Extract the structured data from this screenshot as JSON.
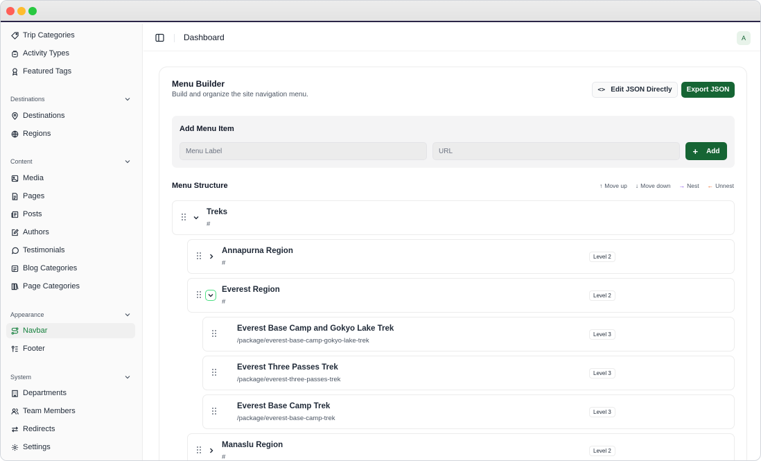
{
  "sidebar": {
    "top_items": [
      {
        "label": "Trip Categories",
        "icon": "tag-icon"
      },
      {
        "label": "Activity Types",
        "icon": "backpack-icon"
      },
      {
        "label": "Featured Tags",
        "icon": "ribbon-icon"
      }
    ],
    "groups": [
      {
        "label": "Destinations",
        "items": [
          {
            "label": "Destinations",
            "icon": "map-pin-icon"
          },
          {
            "label": "Regions",
            "icon": "globe-icon"
          }
        ]
      },
      {
        "label": "Content",
        "items": [
          {
            "label": "Media",
            "icon": "image-icon"
          },
          {
            "label": "Pages",
            "icon": "file-icon"
          },
          {
            "label": "Posts",
            "icon": "newspaper-icon"
          },
          {
            "label": "Authors",
            "icon": "pen-square-icon"
          },
          {
            "label": "Testimonials",
            "icon": "message-circle-icon"
          },
          {
            "label": "Blog Categories",
            "icon": "list-icon"
          },
          {
            "label": "Page Categories",
            "icon": "library-icon"
          }
        ]
      },
      {
        "label": "Appearance",
        "items": [
          {
            "label": "Navbar",
            "icon": "route-icon",
            "active": true
          },
          {
            "label": "Footer",
            "icon": "footer-icon"
          }
        ]
      },
      {
        "label": "System",
        "items": [
          {
            "label": "Departments",
            "icon": "building-icon"
          },
          {
            "label": "Team Members",
            "icon": "users-icon"
          },
          {
            "label": "Redirects",
            "icon": "arrows-icon"
          },
          {
            "label": "Settings",
            "icon": "gear-icon"
          }
        ]
      }
    ]
  },
  "header": {
    "title": "Dashboard",
    "avatar": "A"
  },
  "menu_builder": {
    "title": "Menu Builder",
    "subtitle": "Build and organize the site navigation menu.",
    "edit_json_label": "Edit JSON Directly",
    "export_json_label": "Export JSON"
  },
  "add_menu_item": {
    "title": "Add Menu Item",
    "label_placeholder": "Menu Label",
    "url_placeholder": "URL",
    "add_label": "Add"
  },
  "menu_structure": {
    "title": "Menu Structure",
    "actions": {
      "move_up": "Move up",
      "move_down": "Move down",
      "nest": "Nest",
      "unnest": "Unnest"
    },
    "nodes": [
      {
        "label": "Treks",
        "url": "#",
        "level_badge": "",
        "expanded": true,
        "has_children": true
      },
      {
        "label": "Annapurna Region",
        "url": "#",
        "level_badge": "Level 2",
        "expanded": false,
        "has_children": true
      },
      {
        "label": "Everest Region",
        "url": "#",
        "level_badge": "Level 2",
        "expanded": true,
        "has_children": true,
        "focused": true
      },
      {
        "label": "Everest Base Camp and Gokyo Lake Trek",
        "url": "/package/everest-base-camp-gokyo-lake-trek",
        "level_badge": "Level 3",
        "has_children": false
      },
      {
        "label": "Everest Three Passes Trek",
        "url": "/package/everest-three-passes-trek",
        "level_badge": "Level 3",
        "has_children": false
      },
      {
        "label": "Everest Base Camp Trek",
        "url": "/package/everest-base-camp-trek",
        "level_badge": "Level 3",
        "has_children": false
      },
      {
        "label": "Manaslu Region",
        "url": "#",
        "level_badge": "Level 2",
        "expanded": false,
        "has_children": true
      }
    ]
  },
  "colors": {
    "accent": "#166534",
    "active_nav": "#15803d",
    "nest_arrow": "#7c3aed",
    "unnest_arrow": "#ea580c"
  }
}
